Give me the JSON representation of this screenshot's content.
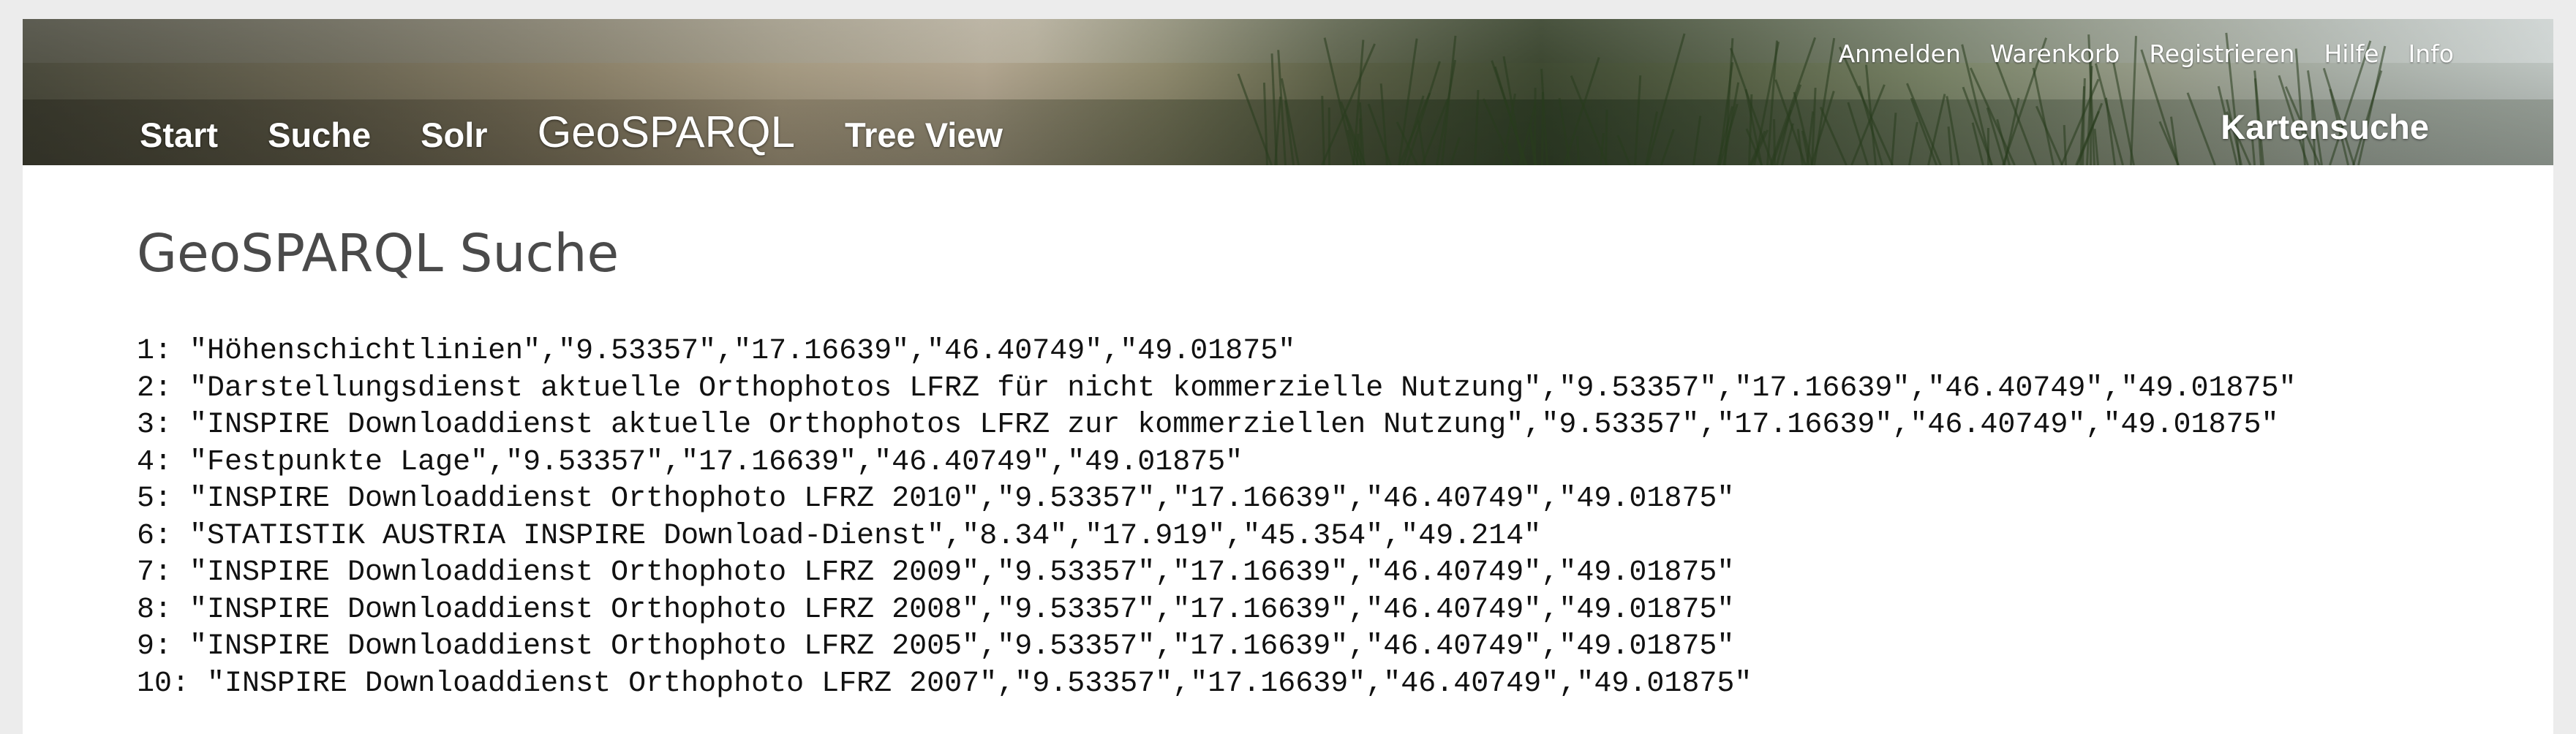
{
  "header": {
    "top_links": [
      "Anmelden",
      "Warenkorb",
      "Registrieren",
      "Hilfe",
      "Info"
    ],
    "nav_items": [
      {
        "label": "Start",
        "active": false
      },
      {
        "label": "Suche",
        "active": false
      },
      {
        "label": "Solr",
        "active": false
      },
      {
        "label": "GeoSPARQL",
        "active": true
      },
      {
        "label": "Tree View",
        "active": false
      }
    ],
    "map_search": "Kartensuche"
  },
  "main": {
    "title": "GeoSPARQL Suche",
    "results": [
      "1: \"Höhenschichtlinien\",\"9.53357\",\"17.16639\",\"46.40749\",\"49.01875\"",
      "2: \"Darstellungsdienst aktuelle Orthophotos LFRZ für nicht kommerzielle Nutzung\",\"9.53357\",\"17.16639\",\"46.40749\",\"49.01875\"",
      "3: \"INSPIRE Downloaddienst aktuelle Orthophotos LFRZ zur kommerziellen Nutzung\",\"9.53357\",\"17.16639\",\"46.40749\",\"49.01875\"",
      "4: \"Festpunkte Lage\",\"9.53357\",\"17.16639\",\"46.40749\",\"49.01875\"",
      "5: \"INSPIRE Downloaddienst Orthophoto LFRZ 2010\",\"9.53357\",\"17.16639\",\"46.40749\",\"49.01875\"",
      "6: \"STATISTIK AUSTRIA INSPIRE Download-Dienst\",\"8.34\",\"17.919\",\"45.354\",\"49.214\"",
      "7: \"INSPIRE Downloaddienst Orthophoto LFRZ 2009\",\"9.53357\",\"17.16639\",\"46.40749\",\"49.01875\"",
      "8: \"INSPIRE Downloaddienst Orthophoto LFRZ 2008\",\"9.53357\",\"17.16639\",\"46.40749\",\"49.01875\"",
      "9: \"INSPIRE Downloaddienst Orthophoto LFRZ 2005\",\"9.53357\",\"17.16639\",\"46.40749\",\"49.01875\"",
      "10: \"INSPIRE Downloaddienst Orthophoto LFRZ 2007\",\"9.53357\",\"17.16639\",\"46.40749\",\"49.01875\""
    ]
  }
}
